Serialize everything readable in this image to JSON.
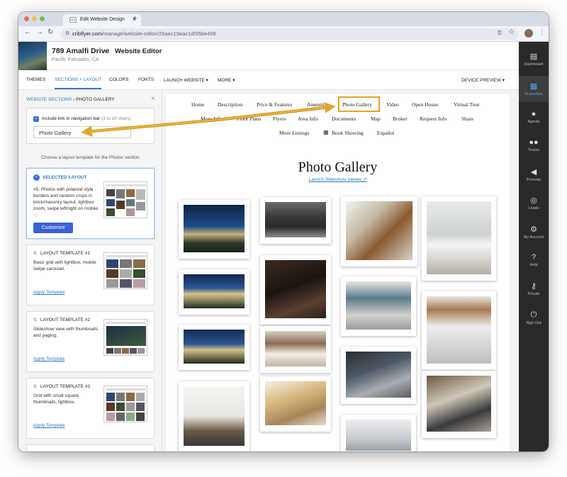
{
  "browser": {
    "tab_title": "Edit Website Design",
    "favicon_text": "CFB",
    "new_tab": "+",
    "url_domain": "cribflyer.com",
    "url_path": "/manage/website-editor/29aec19aac1df35be498"
  },
  "header": {
    "address": "789 Amalfi Drive",
    "city": "Pacific Palisades, CA",
    "separator": "▸",
    "editor_title": "Website Editor"
  },
  "menu": {
    "themes": "THEMES",
    "sections": "SECTIONS + LAYOUT",
    "colors": "COLORS",
    "fonts": "FONTS",
    "launch": "LAUNCH WEBSITE ▾",
    "more": "MORE ▾",
    "device": "DEVICE PREVIEW ▾"
  },
  "left": {
    "crumb_link": "WEBSITE SECTIONS",
    "crumb_sep": "›",
    "crumb_current": "PHOTO GALLERY",
    "close": "×",
    "include_label": "Include link in navigation bar",
    "include_hint": "(3 to 20 chars)",
    "nav_input_value": "Photo Gallery",
    "choose_text": "Choose a layout template for the Photos section",
    "selected": {
      "title": "SELECTED LAYOUT",
      "desc": "#5: Photos with polaroid style borders and random crops in brick/masonry layout, lightbox zoom, swipe left/right on mobile.",
      "customize": "Customize"
    },
    "templates": [
      {
        "title": "LAYOUT TEMPLATE #1",
        "desc": "Basic grid with lightbox, mobile swipe carousel.",
        "apply": "Apply Template"
      },
      {
        "title": "LAYOUT TEMPLATE #2",
        "desc": "Slideshow view with thumbnails and paging.",
        "apply": "Apply Template"
      },
      {
        "title": "LAYOUT TEMPLATE #3",
        "desc": "Grid with small square thumbnails, lightbox.",
        "apply": "Apply Template"
      }
    ]
  },
  "site_nav": {
    "row1": [
      "Home",
      "Description",
      "Price & Features",
      "Amenities",
      "Photo Gallery",
      "Video",
      "Open House",
      "Virtual Tour"
    ],
    "row2": [
      "More Info",
      "Floor Plans",
      "Flyers",
      "Area Info",
      "Documents",
      "Map",
      "Broker",
      "Request Info",
      "Share"
    ],
    "row3": [
      "More Listings",
      "Book Showing",
      "Español"
    ],
    "highlight_color": "#e0a52a"
  },
  "gallery": {
    "title": "Photo Gallery",
    "slideshow_link": "Launch Slideshow Viewer ↗"
  },
  "sidebar": [
    {
      "icon": "dashboard-icon",
      "glyph": "▤",
      "label": "Dashboard"
    },
    {
      "icon": "properties-icon",
      "glyph": "▦",
      "label": "Properties"
    },
    {
      "icon": "agents-icon",
      "glyph": "●",
      "label": "Agents"
    },
    {
      "icon": "teams-icon",
      "glyph": "●●",
      "label": "Teams"
    },
    {
      "icon": "promote-icon",
      "glyph": "◀",
      "label": "Promote"
    },
    {
      "icon": "leads-icon",
      "glyph": "◎",
      "label": "Leads"
    },
    {
      "icon": "account-icon",
      "glyph": "⚙",
      "label": "My Account"
    },
    {
      "icon": "help-icon",
      "glyph": "?",
      "label": "Help"
    },
    {
      "icon": "private-icon",
      "glyph": "⚷",
      "label": "Private"
    },
    {
      "icon": "signout-icon",
      "glyph": "⏻",
      "label": "Sign Out"
    }
  ],
  "accent": "#2f7bbf"
}
